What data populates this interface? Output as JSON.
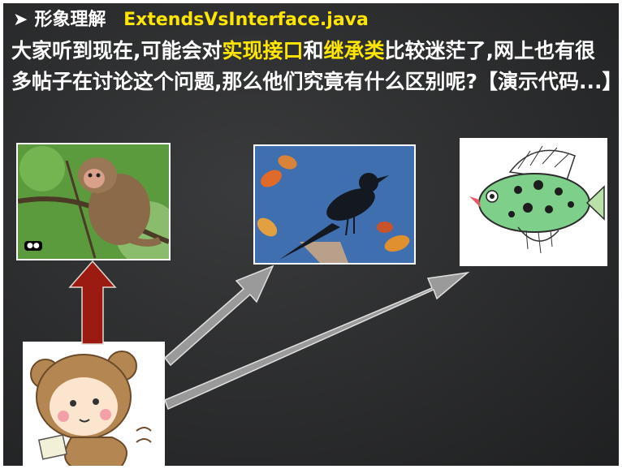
{
  "heading": {
    "prefix": "形象理解",
    "filename": "ExtendsVsInterface.java"
  },
  "paragraph": {
    "part1": "大家听到现在,可能会对",
    "highlight1": "实现接口",
    "part2": "和",
    "highlight2": "继承类",
    "part3": "比较迷茫了,网上也有很多帖子在讨论这个问题,那么他们究竟有什么区别呢?【演示代码...】"
  },
  "colors": {
    "highlight": "#ffe600",
    "inherit_arrow": "#9b1a12",
    "interface_arrow": "#a8a8a8"
  },
  "images": [
    "monkey-photo",
    "bird-photo",
    "fish-drawing",
    "bear-cartoon"
  ]
}
